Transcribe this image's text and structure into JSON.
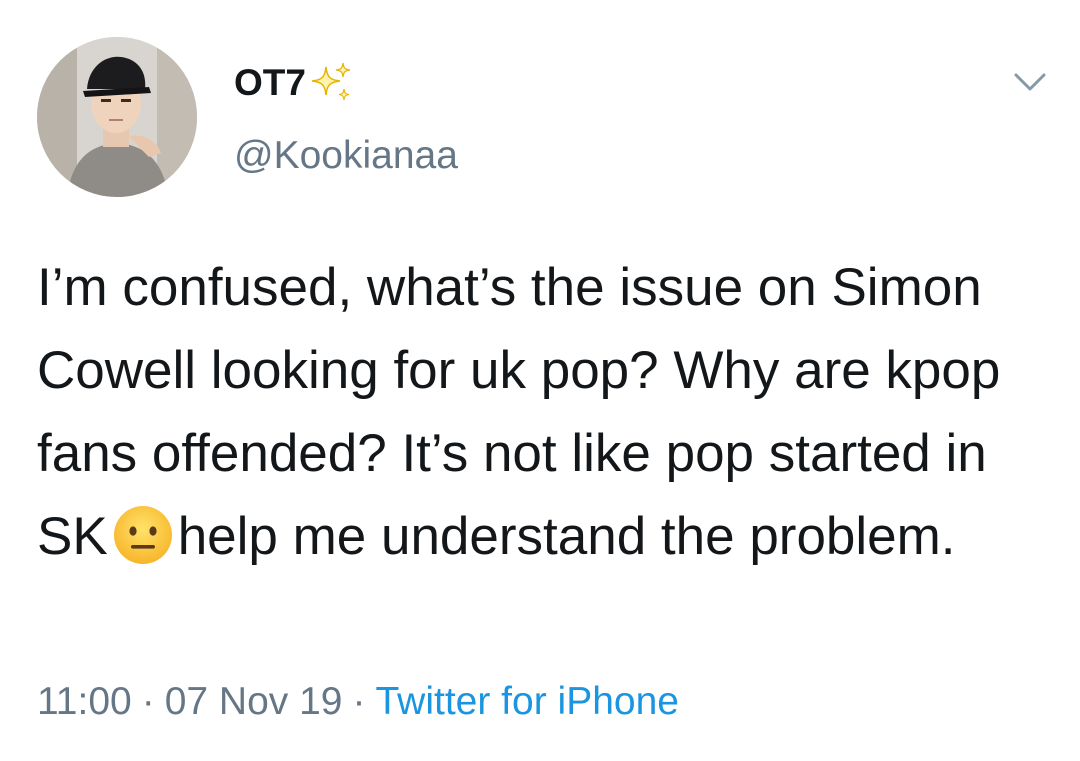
{
  "user": {
    "display_name": "OT7",
    "name_emoji": "sparkles-icon",
    "handle": "@Kookianaa",
    "avatar": "profile-avatar"
  },
  "tweet": {
    "text_before_emoji": "I’m confused, what’s the issue on Simon Cowell looking for uk pop? Why are kpop fans offended? It’s not like pop started in SK",
    "emoji": "neutral-face-icon",
    "text_after_emoji": "help me understand the problem.",
    "time": "11:00",
    "date": "07 Nov 19",
    "separator": "·",
    "source": "Twitter for iPhone"
  },
  "menu": {
    "icon": "chevron-down-icon"
  },
  "colors": {
    "text": "#14171a",
    "secondary": "#657786",
    "link": "#1b95e0",
    "sparkle": "#f5c518"
  }
}
